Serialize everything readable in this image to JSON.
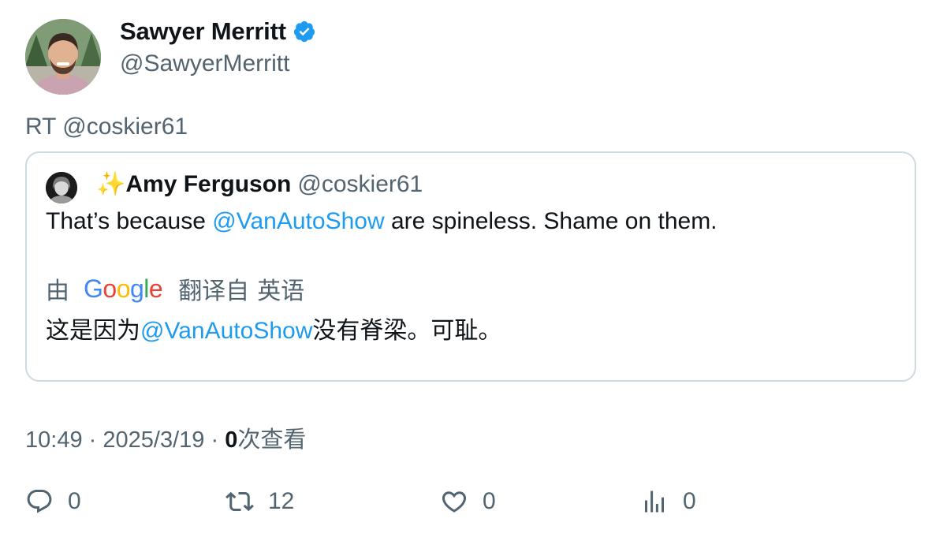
{
  "author": {
    "name": "Sawyer Merritt",
    "handle": "@SawyerMerritt",
    "verified": true
  },
  "retweet_line": "RT @coskier61",
  "quoted": {
    "name": "✨Amy Ferguson",
    "handle": "@coskier61",
    "text_before": "That’s because ",
    "mention": "@VanAutoShow",
    "text_after": " are spineless. Shame on them.",
    "translation": {
      "by_label": "由",
      "provider": "Google",
      "from_label": "翻译自",
      "language": "英语",
      "text_before": "这是因为",
      "mention": "@VanAutoShow",
      "text_after": "没有脊梁。可耻。"
    }
  },
  "meta": {
    "time": "10:49",
    "separator": "·",
    "date": "2025/3/19",
    "views_count": "0",
    "views_label": "次查看"
  },
  "actions": {
    "reply_count": "0",
    "retweet_count": "12",
    "like_count": "0",
    "views_count": "0"
  },
  "colors": {
    "text_primary": "#0f1419",
    "text_secondary": "#536471",
    "accent": "#1d9bf0",
    "border": "#cfd9de"
  },
  "icons": {
    "verified": "verified-badge-icon",
    "reply": "reply-icon",
    "retweet": "retweet-icon",
    "like": "heart-icon",
    "views": "bar-chart-icon"
  }
}
